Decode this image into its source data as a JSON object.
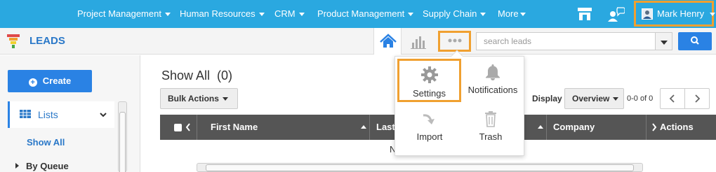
{
  "topnav": {
    "items": [
      {
        "label": "Project Management"
      },
      {
        "label": "Human Resources"
      },
      {
        "label": "CRM"
      },
      {
        "label": "Product Management"
      },
      {
        "label": "Supply Chain"
      },
      {
        "label": "More"
      }
    ],
    "user_name": "Mark Henry",
    "icons": [
      "store-icon",
      "people-chat-icon",
      "avatar"
    ]
  },
  "subbar": {
    "title": "LEADS",
    "search_placeholder": "search leads",
    "icons": [
      "funnel-icon",
      "home-icon",
      "bar-chart-icon",
      "more-dots-icon",
      "search-icon"
    ]
  },
  "sidebar": {
    "create_label": "Create",
    "lists_label": "Lists",
    "show_all_label": "Show All",
    "by_queue_label": "By Queue"
  },
  "main": {
    "title": "Show All  (0)",
    "bulk_actions_label": "Bulk Actions",
    "display_label": "Display",
    "overview_label": "Overview",
    "range_text": "0-0 of 0",
    "columns": [
      "First Name",
      "Last",
      "Company",
      "Actions"
    ],
    "no_records_partial": "N"
  },
  "dropdown": {
    "items": [
      {
        "label": "Settings",
        "icon": "gear-icon"
      },
      {
        "label": "Notifications",
        "icon": "bell-icon"
      },
      {
        "label": "Import",
        "icon": "import-arrow-icon"
      },
      {
        "label": "Trash",
        "icon": "trash-icon"
      }
    ]
  },
  "colors": {
    "nav_bg": "#2aa8e0",
    "accent_blue": "#2a82e4",
    "highlight_orange": "#f0a030",
    "table_header": "#555555"
  }
}
